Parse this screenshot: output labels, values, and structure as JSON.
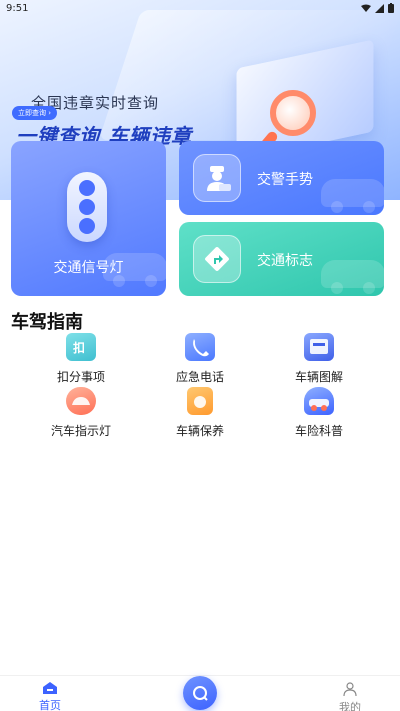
{
  "status": {
    "time": "9:51",
    "icons": [
      "wifi-icon",
      "signal-icon",
      "battery-icon"
    ]
  },
  "hero": {
    "subtitle": "全国违章实时查询",
    "link_label": "立即查询",
    "title": "一键查询 车辆违章"
  },
  "cards": {
    "traffic_light": {
      "label": "交通信号灯",
      "icon": "traffic-light-icon"
    },
    "police_gesture": {
      "label": "交警手势",
      "icon": "police-icon"
    },
    "traffic_sign": {
      "label": "交通标志",
      "icon": "traffic-sign-icon"
    }
  },
  "guide": {
    "title": "车驾指南",
    "items": [
      {
        "label": "扣分事项",
        "icon": "deduct-points-icon"
      },
      {
        "label": "应急电话",
        "icon": "emergency-phone-icon"
      },
      {
        "label": "车辆图解",
        "icon": "vehicle-diagram-icon"
      },
      {
        "label": "汽车指示灯",
        "icon": "dashboard-light-icon"
      },
      {
        "label": "车辆保养",
        "icon": "maintenance-icon"
      },
      {
        "label": "车险科普",
        "icon": "car-insurance-icon"
      }
    ]
  },
  "tabs": {
    "home": "首页",
    "mine": "我的"
  },
  "colors": {
    "accent": "#3d63ff",
    "card_blue": "#5079ff",
    "card_teal": "#2fc6ad"
  }
}
